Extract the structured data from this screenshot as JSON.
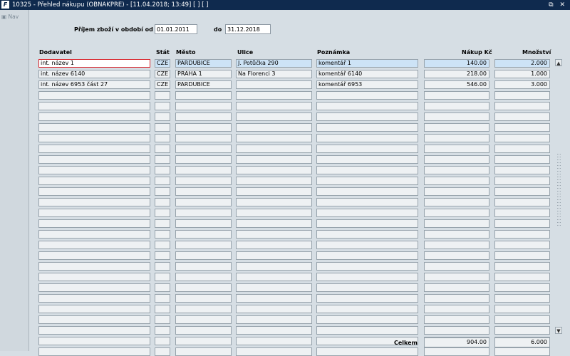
{
  "window": {
    "title": "10325 - Přehled nákupu (OBNAKPRE) - [11.04.2018; 13:49]  [ ]  [ ]",
    "app_icon": "forms-icon",
    "buttons": "⧉ ✕"
  },
  "sidebar": {
    "nav_label": "Nav"
  },
  "filter": {
    "label": "Příjem zboží v období od",
    "from": "01.01.2011",
    "to_label": "do",
    "to": "31.12.2018"
  },
  "table": {
    "headers": {
      "supplier": "Dodavatel",
      "country": "Stát",
      "city": "Město",
      "street": "Ulice",
      "note": "Poznámka",
      "price": "Nákup Kč",
      "qty": "Množství"
    },
    "rows": [
      {
        "supplier": "int. název 1",
        "country": "CZE",
        "city": "PARDUBICE",
        "street": "J. Potůčka 290",
        "note": "komentář 1",
        "price": "140.00",
        "qty": "2.000"
      },
      {
        "supplier": "int. název 6140",
        "country": "CZE",
        "city": "PRAHA 1",
        "street": "Na Florenci 3",
        "note": "komentář 6140",
        "price": "218.00",
        "qty": "1.000"
      },
      {
        "supplier": "int. název 6953 část 27",
        "country": "CZE",
        "city": "PARDUBICE",
        "street": "",
        "note": "komentář 6953",
        "price": "546.00",
        "qty": "3.000"
      }
    ],
    "empty_row_count": 25
  },
  "totals": {
    "label": "Celkem",
    "price": "904.00",
    "qty": "6.000"
  },
  "colors": {
    "titlebar": "#0f2a4e",
    "background": "#d6dee4",
    "selected_row": "#cde3f6",
    "focus_border": "#d7262e"
  }
}
